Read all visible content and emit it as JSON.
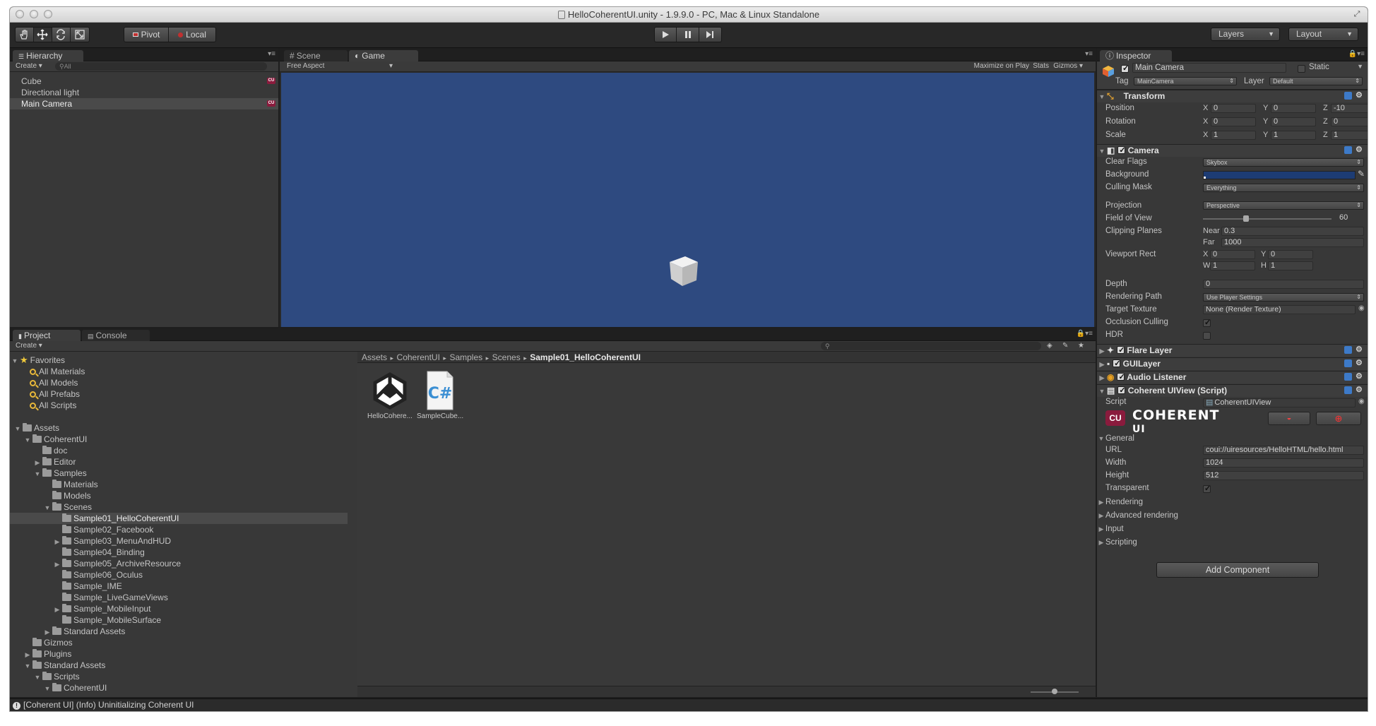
{
  "window": {
    "title": "HelloCoherentUI.unity - 1.9.9.0 - PC, Mac & Linux Standalone"
  },
  "toolbar": {
    "pivot": "Pivot",
    "local": "Local",
    "layers": "Layers",
    "layout": "Layout"
  },
  "hierarchy": {
    "tab": "Hierarchy",
    "create": "Create",
    "search_placeholder": "All",
    "items": [
      "Cube",
      "Directional light",
      "Main Camera"
    ]
  },
  "scene_tab": "Scene",
  "game": {
    "tab": "Game",
    "aspect": "Free Aspect",
    "maximize": "Maximize on Play",
    "stats": "Stats",
    "gizmos": "Gizmos",
    "bg_color": "#2e4a80"
  },
  "project": {
    "tab": "Project",
    "console_tab": "Console",
    "create": "Create",
    "breadcrumb": [
      "Assets",
      "CoherentUI",
      "Samples",
      "Scenes",
      "Sample01_HelloCoherentUI"
    ],
    "favorites_label": "Favorites",
    "favorites": [
      "All Materials",
      "All Models",
      "All Prefabs",
      "All Scripts"
    ],
    "tree": [
      {
        "label": "Assets",
        "level": 0,
        "fold": "open"
      },
      {
        "label": "CoherentUI",
        "level": 1,
        "fold": "open"
      },
      {
        "label": "doc",
        "level": 2,
        "fold": ""
      },
      {
        "label": "Editor",
        "level": 2,
        "fold": "closed"
      },
      {
        "label": "Samples",
        "level": 2,
        "fold": "open"
      },
      {
        "label": "Materials",
        "level": 3,
        "fold": ""
      },
      {
        "label": "Models",
        "level": 3,
        "fold": ""
      },
      {
        "label": "Scenes",
        "level": 3,
        "fold": "open"
      },
      {
        "label": "Sample01_HelloCoherentUI",
        "level": 4,
        "fold": "",
        "selected": true
      },
      {
        "label": "Sample02_Facebook",
        "level": 4,
        "fold": ""
      },
      {
        "label": "Sample03_MenuAndHUD",
        "level": 4,
        "fold": "closed"
      },
      {
        "label": "Sample04_Binding",
        "level": 4,
        "fold": ""
      },
      {
        "label": "Sample05_ArchiveResource",
        "level": 4,
        "fold": "closed"
      },
      {
        "label": "Sample06_Oculus",
        "level": 4,
        "fold": ""
      },
      {
        "label": "Sample_IME",
        "level": 4,
        "fold": ""
      },
      {
        "label": "Sample_LiveGameViews",
        "level": 4,
        "fold": ""
      },
      {
        "label": "Sample_MobileInput",
        "level": 4,
        "fold": "closed"
      },
      {
        "label": "Sample_MobileSurface",
        "level": 4,
        "fold": ""
      },
      {
        "label": "Standard Assets",
        "level": 3,
        "fold": "closed"
      },
      {
        "label": "Gizmos",
        "level": 1,
        "fold": ""
      },
      {
        "label": "Plugins",
        "level": 1,
        "fold": "closed"
      },
      {
        "label": "Standard Assets",
        "level": 1,
        "fold": "open"
      },
      {
        "label": "Scripts",
        "level": 2,
        "fold": "open"
      },
      {
        "label": "CoherentUI",
        "level": 3,
        "fold": "open"
      }
    ],
    "assets": [
      {
        "label": "HelloCohere...",
        "icon": "unity-scene-icon"
      },
      {
        "label": "SampleCube...",
        "icon": "csharp-script-icon"
      }
    ]
  },
  "inspector": {
    "tab": "Inspector",
    "object_name": "Main Camera",
    "static": "Static",
    "tag_label": "Tag",
    "tag": "MainCamera",
    "layer_label": "Layer",
    "layer": "Default",
    "transform": {
      "title": "Transform",
      "position": {
        "label": "Position",
        "x": "0",
        "y": "0",
        "z": "-10"
      },
      "rotation": {
        "label": "Rotation",
        "x": "0",
        "y": "0",
        "z": "0"
      },
      "scale": {
        "label": "Scale",
        "x": "1",
        "y": "1",
        "z": "1"
      }
    },
    "camera": {
      "title": "Camera",
      "clear_flags_label": "Clear Flags",
      "clear_flags": "Skybox",
      "background_label": "Background",
      "background_color": "#1d3c74",
      "culling_label": "Culling Mask",
      "culling": "Everything",
      "projection_label": "Projection",
      "projection": "Perspective",
      "fov_label": "Field of View",
      "fov": "60",
      "fov_fraction": 0.33,
      "clipping_label": "Clipping Planes",
      "near_label": "Near",
      "near": "0.3",
      "far_label": "Far",
      "far": "1000",
      "viewport_label": "Viewport Rect",
      "vx": "0",
      "vy": "0",
      "vw": "1",
      "vh": "1",
      "depth_label": "Depth",
      "depth": "0",
      "rendering_path_label": "Rendering Path",
      "rendering_path": "Use Player Settings",
      "target_label": "Target Texture",
      "target": "None (Render Texture)",
      "occlusion_label": "Occlusion Culling",
      "hdr_label": "HDR"
    },
    "flare": "Flare Layer",
    "guilayer": "GUILayer",
    "audio": "Audio Listener",
    "coherent": {
      "title": "Coherent UIView (Script)",
      "script_label": "Script",
      "script": "CoherentUIView",
      "logo_text": "COHERENT",
      "logo_sub": "UI",
      "general": "General",
      "url_label": "URL",
      "url": "coui://uiresources/HelloHTML/hello.html",
      "width_label": "Width",
      "width": "1024",
      "height_label": "Height",
      "height": "512",
      "transparent_label": "Transparent",
      "sections": [
        "Rendering",
        "Advanced rendering",
        "Input",
        "Scripting"
      ]
    },
    "add_component": "Add Component"
  },
  "status": "[Coherent UI] (Info) Uninitializing Coherent UI"
}
